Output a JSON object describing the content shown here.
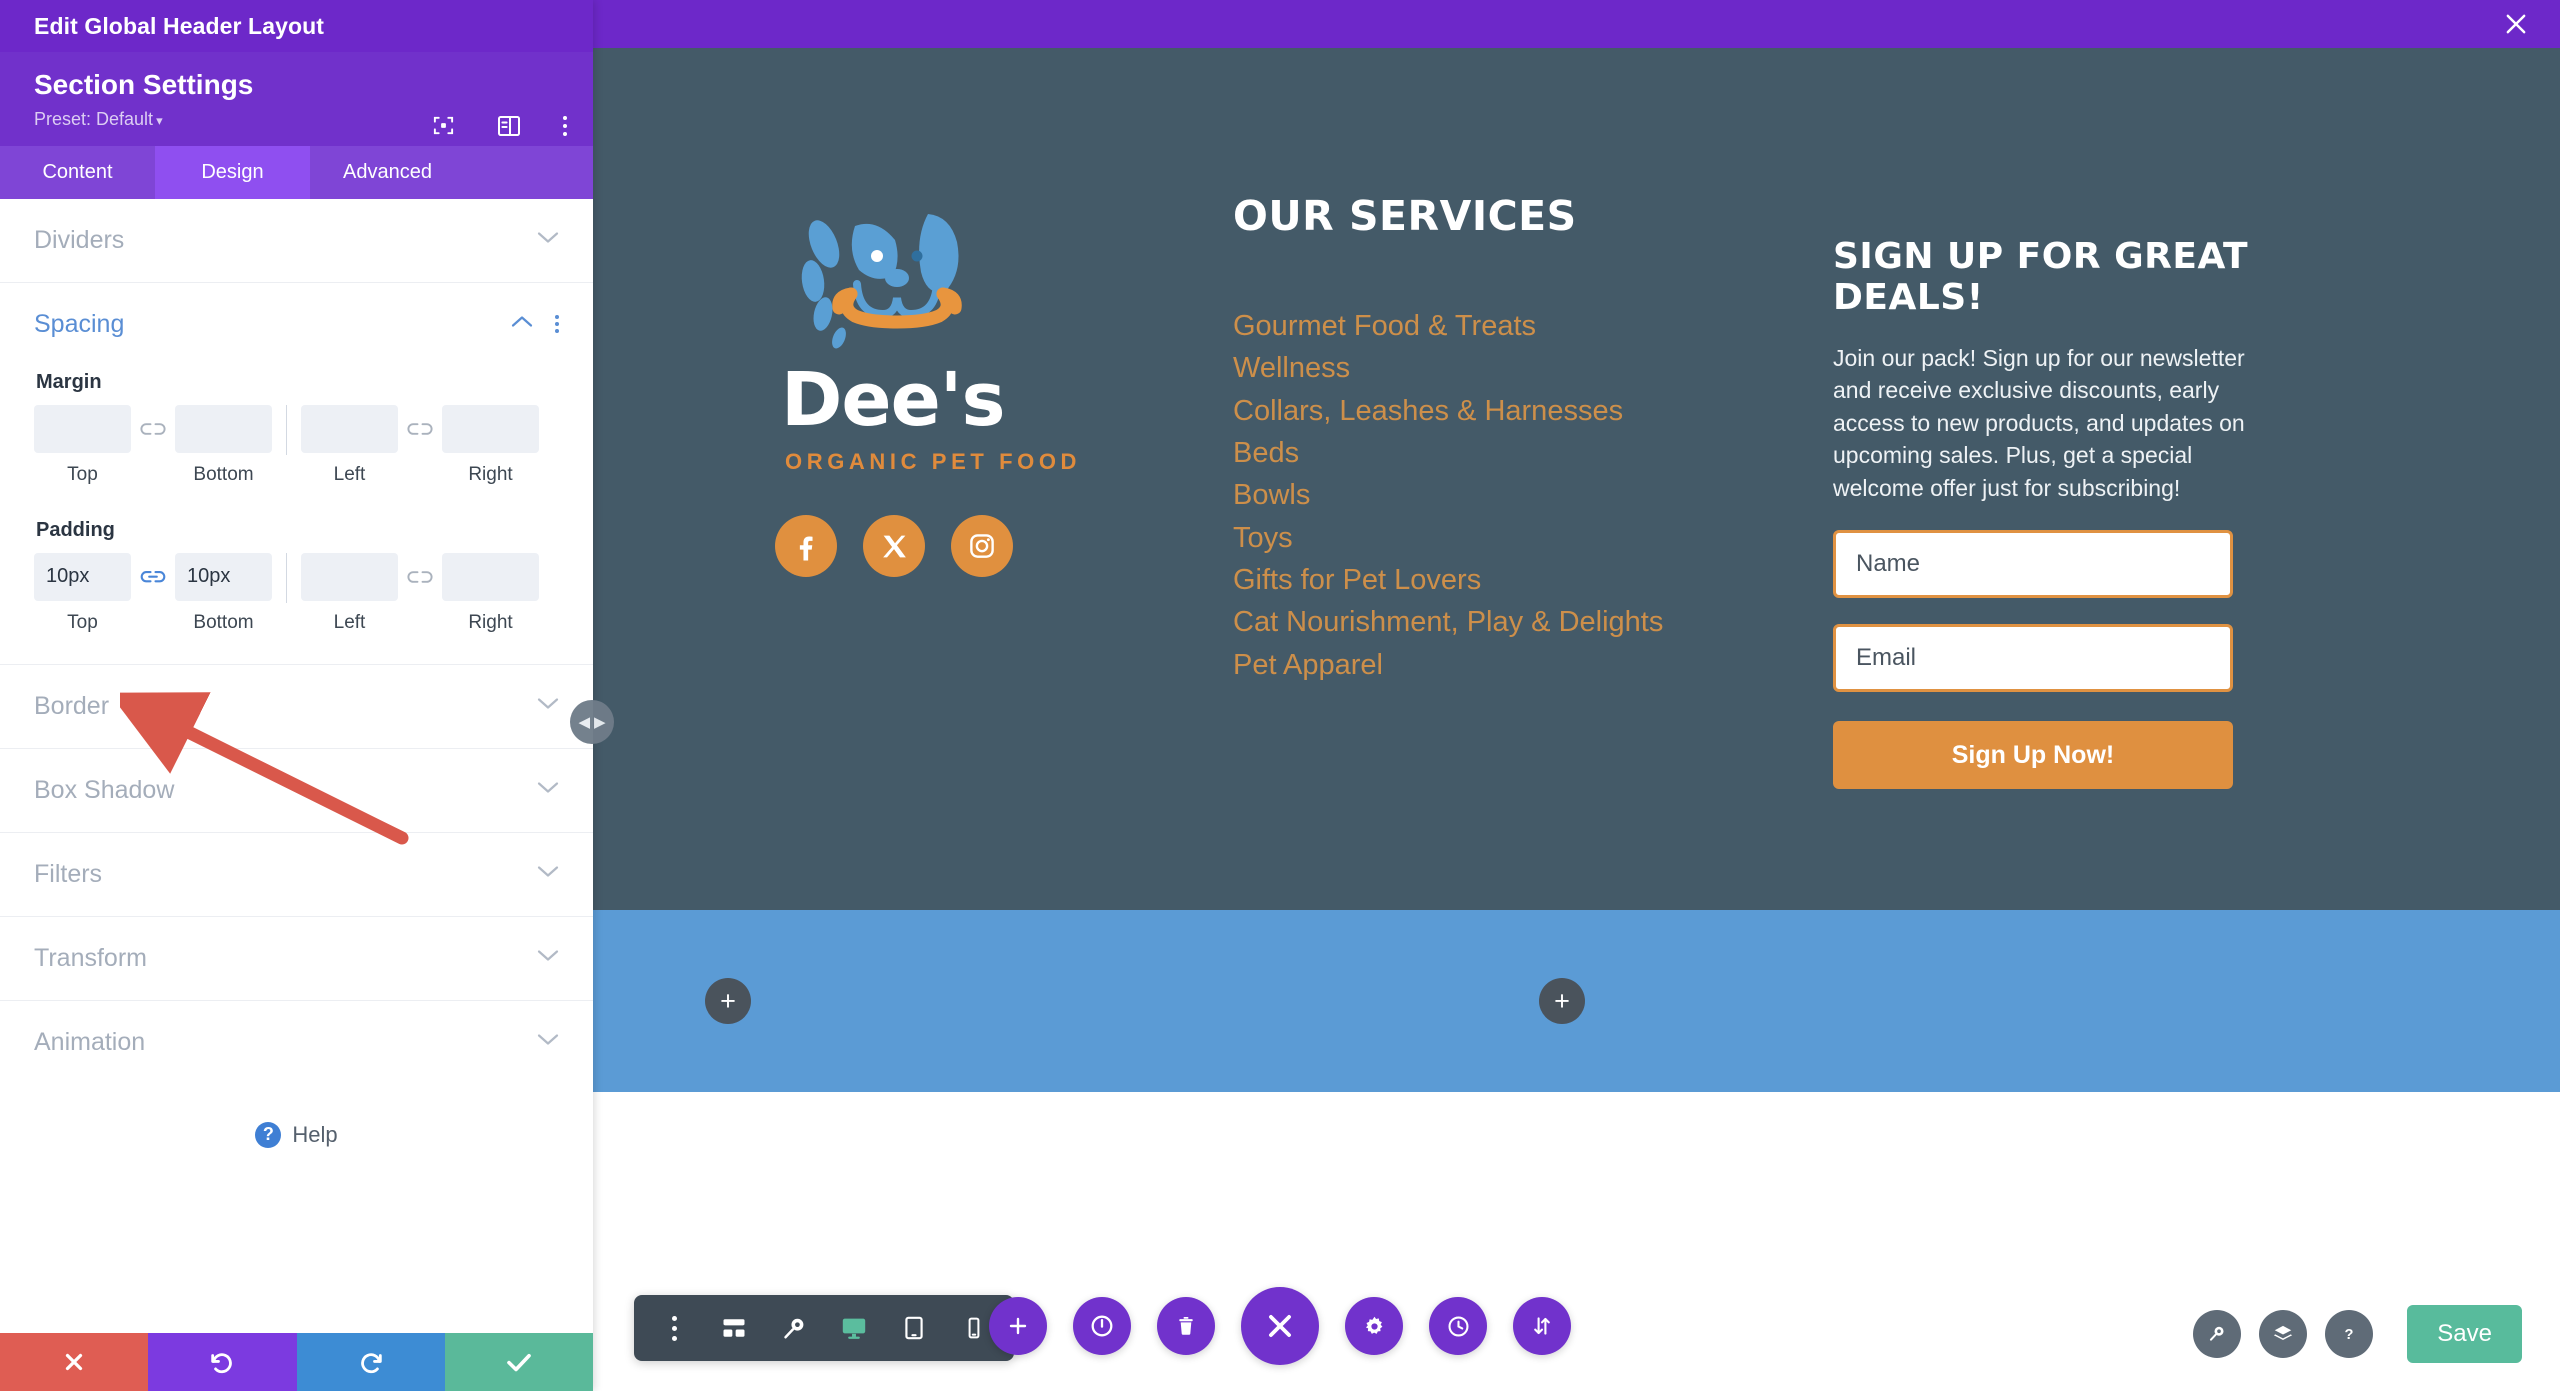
{
  "panel": {
    "window_title": "Edit Global Header Layout",
    "close_icon": "close-icon",
    "heading": "Section Settings",
    "preset_label": "Preset: Default",
    "preset_caret": "▾",
    "head_icons": [
      "focus-target-icon",
      "layout-panel-icon",
      "kebab-menu-icon"
    ],
    "tabs": [
      {
        "label": "Content",
        "active": false
      },
      {
        "label": "Design",
        "active": true
      },
      {
        "label": "Advanced",
        "active": false
      }
    ],
    "sections": {
      "dividers": {
        "label": "Dividers",
        "open": false
      },
      "spacing": {
        "label": "Spacing",
        "open": true
      },
      "border": {
        "label": "Border",
        "open": false
      },
      "box_shadow": {
        "label": "Box Shadow",
        "open": false
      },
      "filters": {
        "label": "Filters",
        "open": false
      },
      "transform": {
        "label": "Transform",
        "open": false
      },
      "animation": {
        "label": "Animation",
        "open": false
      }
    },
    "spacing": {
      "margin": {
        "label": "Margin",
        "link_state": "unlinked",
        "top": {
          "value": "",
          "placeholder": "",
          "caption": "Top"
        },
        "bottom": {
          "value": "",
          "placeholder": "",
          "caption": "Bottom"
        },
        "left": {
          "value": "",
          "placeholder": "",
          "caption": "Left"
        },
        "right": {
          "value": "",
          "placeholder": "",
          "caption": "Right"
        }
      },
      "padding": {
        "label": "Padding",
        "link_state": "linked",
        "top": {
          "value": "10px",
          "placeholder": "",
          "caption": "Top"
        },
        "bottom": {
          "value": "10px",
          "placeholder": "",
          "caption": "Bottom"
        },
        "left": {
          "value": "",
          "placeholder": "",
          "caption": "Left"
        },
        "right": {
          "value": "",
          "placeholder": "",
          "caption": "Right"
        }
      }
    },
    "help": {
      "label": "Help",
      "icon": "question-circle-icon"
    },
    "footer": [
      {
        "name": "cancel",
        "icon": "close-icon",
        "color": "#df5d53"
      },
      {
        "name": "undo",
        "icon": "undo-icon",
        "color": "#7c3ae0"
      },
      {
        "name": "redo",
        "icon": "redo-icon",
        "color": "#3d8cd4"
      },
      {
        "name": "save",
        "icon": "check-icon",
        "color": "#5ab99a"
      }
    ],
    "resize_handle": {
      "left_arrow": "◀",
      "right_arrow": "▶"
    }
  },
  "preview": {
    "background_dark": "#445a68",
    "accent_orange": "#e0903f",
    "blue_row_color": "#5b9bd5",
    "logo": {
      "brand": "Dee's",
      "tagline": "ORGANIC PET FOOD",
      "mark": "dog-face-icon"
    },
    "socials": [
      {
        "name": "facebook-icon",
        "label": "Facebook"
      },
      {
        "name": "x-twitter-icon",
        "label": "X"
      },
      {
        "name": "instagram-icon",
        "label": "Instagram"
      }
    ],
    "services": {
      "heading": "Our Services",
      "items": [
        "Gourmet Food & Treats",
        "Wellness",
        "Collars, Leashes & Harnesses",
        "Beds",
        "Bowls",
        "Toys",
        "Gifts for Pet Lovers",
        "Cat Nourishment, Play & Delights",
        "Pet Apparel"
      ]
    },
    "signup": {
      "heading": "Sign up for great deals!",
      "description": "Join our pack! Sign up for our newsletter and receive exclusive discounts, early access to new products, and updates on upcoming sales. Plus, get a special welcome offer just for subscribing!",
      "name_placeholder": "Name",
      "name_value": "",
      "email_placeholder": "Email",
      "email_value": "",
      "button_label": "Sign Up Now!"
    },
    "add_buttons": [
      {
        "label": "+",
        "name": "add-row-left"
      },
      {
        "label": "+",
        "name": "add-row-right"
      }
    ]
  },
  "toolbars": {
    "device": [
      {
        "name": "kebab-menu-icon",
        "active": false
      },
      {
        "name": "wireframe-icon",
        "active": false
      },
      {
        "name": "zoom-icon",
        "active": false
      },
      {
        "name": "desktop-icon",
        "active": true
      },
      {
        "name": "tablet-icon",
        "active": false
      },
      {
        "name": "phone-icon",
        "active": false
      }
    ],
    "main": [
      {
        "name": "plus-icon",
        "big": false
      },
      {
        "name": "power-icon",
        "big": false
      },
      {
        "name": "trash-icon",
        "big": false
      },
      {
        "name": "close-icon",
        "big": true
      },
      {
        "name": "gear-icon",
        "big": false
      },
      {
        "name": "history-clock-icon",
        "big": false
      },
      {
        "name": "sort-arrows-icon",
        "big": false
      }
    ],
    "right": [
      {
        "name": "search-zoom-icon"
      },
      {
        "name": "layers-icon"
      },
      {
        "name": "help-question-icon"
      }
    ],
    "save_label": "Save"
  },
  "annotation": {
    "type": "arrow",
    "color": "#d9584b"
  }
}
